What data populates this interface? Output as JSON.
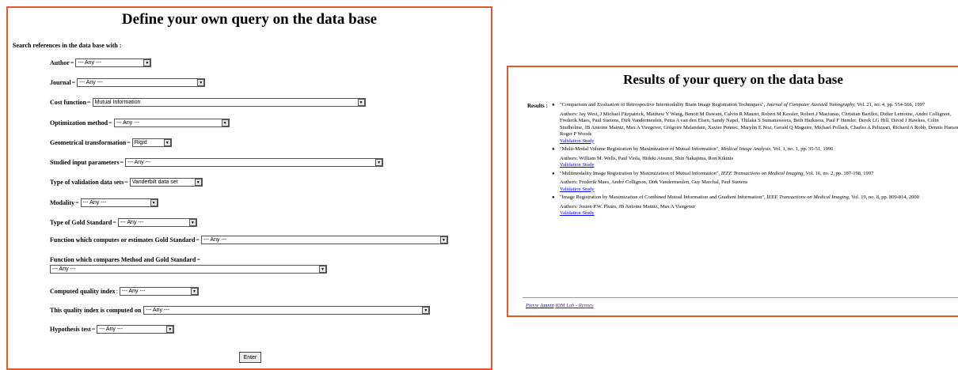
{
  "left_panel": {
    "title": "Define your own query on the data base",
    "section_label": "Search references in the data base with :",
    "fields": [
      {
        "label": "Author",
        "sep": "=",
        "value": "--- Any ---"
      },
      {
        "label": "Journal",
        "sep": "=",
        "value": "--- Any ---"
      },
      {
        "label": "Cost function",
        "sep": "=",
        "value": "Mutual Information"
      },
      {
        "label": "Optimization method",
        "sep": "=",
        "value": "--- Any ---"
      },
      {
        "label": "Geometrical transformation",
        "sep": "=",
        "value": "Rigid"
      },
      {
        "label": "Studied input parameters",
        "sep": "=",
        "value": "--- Any ---"
      },
      {
        "label": "Type of validation data sets",
        "sep": "=",
        "value": "Vanderbilt data set"
      },
      {
        "label": "Modality",
        "sep": "=",
        "value": "--- Any ---"
      },
      {
        "label": "Type of Gold Standard",
        "sep": "=",
        "value": "--- Any ---"
      },
      {
        "label": "Function which computes or estimates Gold Standard",
        "sep": "=",
        "value": "--- Any ---"
      },
      {
        "label": "Function which compares Method and Gold Standard",
        "sep": "=",
        "value": "--- Any ---"
      },
      {
        "label": "Computed quality index",
        "sep": ":",
        "value": "--- Any ---"
      },
      {
        "label": "This quality index is computed on",
        "sep": "",
        "value": "--- Any ---"
      },
      {
        "label": "Hypothesis test",
        "sep": "=",
        "value": "--- Any ---"
      }
    ],
    "enter_label": "Enter"
  },
  "right_panel": {
    "title": "Results of your query on the data base",
    "results_label": "Results :",
    "results": [
      {
        "title": "\"Comparison and Evaluation of Retrospective Intermodality Brain Image Registration Techniques\",",
        "journal": "Journal of Computer Assisted Tomography,",
        "details": "Vol. 21, no. 4, pp. 554-566, 1997",
        "authors": "Authors: Jay West, J Michael Fitzpatrick, Matthew Y Wang, Benoit M Dawant, Calvin R Maurer, Robert M Kessler, Robert J Maciunas, Christian Barillot, Didier Lemoine, André Collignon, Frederik Maes, Paul Suetens, Dirk Vandermeulen, Petra A van den Elsen, Sandy Napel, Thilaka S Sumanaweera, Beth Harkness, Paul F Hemler, Derek LG Hill, David J Hawkes, Colin Studholme, JB Antoine Maintz, Max A Viergever, Grégoire Malandain, Xavier Pennec, Marylin E Noz, Gerald Q Maguire, Michael Pollack, Charles A Pelizzari, Richard A Robb, Dennis Hanson, Roger P Woods",
        "link": "Validation Study"
      },
      {
        "title": "\"Multi-Modal Volume Registration by Maximization of Mutual Information\",",
        "journal": "Medical Image Analysis,",
        "details": "Vol. 1, no. 1, pp. 35-51, 1996",
        "authors": "Authors: William M. Wells, Paul Viola, Hideki Atsumi, Shin Nakajima, Ron Kikinis",
        "link": "Validation Study"
      },
      {
        "title": "\"Multimodality Image Registration by Maximization of Mutual Information\",",
        "journal": "IEEE Transactions on Medical Imaging,",
        "details": "Vol. 16, no. 2, pp. 187-198, 1997",
        "authors": "Authors: Frederik Maes, André Collignon, Dirk Vandermeulen, Guy Marchal, Paul Suetens",
        "link": "Validation Study"
      },
      {
        "title": "\"Image Registration by Maximization of Combined Mutual Information and Gradient Information\",",
        "journal": "IEEE Transactions on Medical Imaging,",
        "details": "Vol. 19, no. 8, pp. 809-814, 2000",
        "authors": "Authors: Josien P.W. Pluim, JB Antoine Maintz, Max A Viergever",
        "link": "Validation Study"
      }
    ],
    "footer_author": "Pierre Jannin",
    "footer_lab": "IDM Lab - Rennes"
  },
  "colors": {
    "panel_border": "#e8572a",
    "link": "#0000ee"
  }
}
